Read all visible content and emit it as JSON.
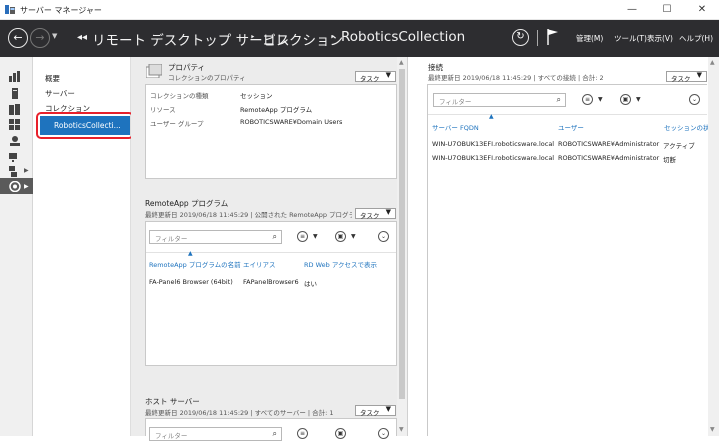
{
  "window": {
    "title": "サーバー マネージャー",
    "min": "—",
    "max": "☐",
    "close": "✕"
  },
  "nav": {
    "back": "←",
    "forward": "→",
    "breadcrumb": [
      "リモート デスクトップ サービス",
      "コレクション",
      "RoboticsCollection"
    ],
    "sep": "‣",
    "menus": [
      "管理(M)",
      "ツール(T)",
      "表示(V)",
      "ヘルプ(H)"
    ]
  },
  "sidebar": {
    "items": [
      "概要",
      "サーバー",
      "コレクション",
      "RoboticsCollecti..."
    ]
  },
  "properties": {
    "title": "プロパティ",
    "subtitle": "コレクションのプロパティ",
    "task_label": "タスク",
    "rows": [
      {
        "label": "コレクションの種類",
        "value": "セッション"
      },
      {
        "label": "リソース",
        "value": "RemoteApp プログラム"
      },
      {
        "label": "ユーザー グループ",
        "value": "ROBOTICSWARE¥Domain Users"
      }
    ]
  },
  "remoteapp": {
    "title": "RemoteApp プログラム",
    "subtitle": "最終更新日 2019/06/18 11:45:29 | 公開された RemoteApp プログラ...",
    "task_label": "タスク",
    "filter_placeholder": "フィルター",
    "columns": [
      "RemoteApp プログラムの名前",
      "エイリアス",
      "RD Web アクセスで表示"
    ],
    "rows": [
      [
        "FA-Panel6 Browser (64bit)",
        "FAPanelBrowser6",
        "はい"
      ]
    ]
  },
  "hostservers": {
    "title": "ホスト サーバー",
    "subtitle": "最終更新日 2019/06/18 11:45:29 | すべてのサーバー | 合計: 1",
    "task_label": "タスク",
    "filter_placeholder": "フィルター"
  },
  "connections": {
    "title": "接続",
    "subtitle": "最終更新日 2019/06/18 11:45:29 | すべての接続 | 合計: 2",
    "task_label": "タスク",
    "filter_placeholder": "フィルター",
    "columns": [
      "サーバー FQDN",
      "ユーザー",
      "セッションの状"
    ],
    "rows": [
      [
        "WIN-U7OBUK13EFI.roboticsware.local",
        "ROBOTICSWARE¥Administrator",
        "アクティブ"
      ],
      [
        "WIN-U7OBUK13EFI.roboticsware.local",
        "ROBOTICSWARE¥Administrator",
        "切断"
      ]
    ]
  },
  "colors": {
    "navbar": "#2d2d30",
    "accent": "#1e73be",
    "highlight": "#e8202b"
  }
}
